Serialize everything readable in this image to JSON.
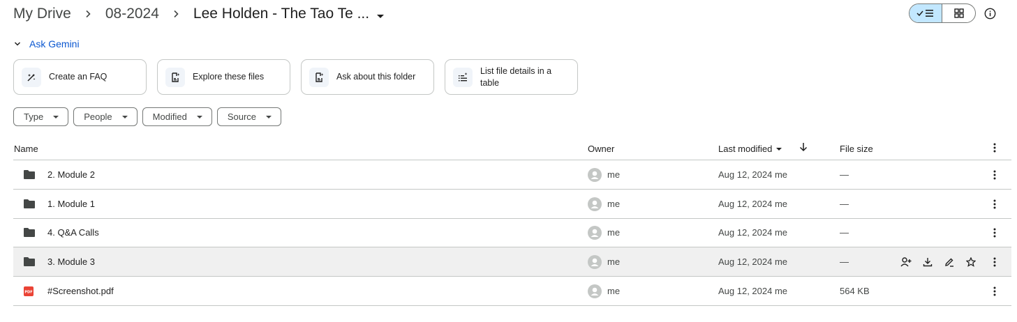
{
  "breadcrumb": {
    "root": "My Drive",
    "parent": "08-2024",
    "current": "Lee Holden - The Tao Te ..."
  },
  "gemini": {
    "label": "Ask Gemini",
    "suggestions": [
      {
        "icon": "magic-pen-icon",
        "label": "Create an FAQ"
      },
      {
        "icon": "doc-sparkle-icon",
        "label": "Explore these files"
      },
      {
        "icon": "doc-sparkle-icon",
        "label": "Ask about this folder"
      },
      {
        "icon": "list-sparkle-icon",
        "label": "List file details in a table"
      }
    ]
  },
  "filters": [
    "Type",
    "People",
    "Modified",
    "Source"
  ],
  "table": {
    "headers": {
      "name": "Name",
      "owner": "Owner",
      "last_modified": "Last modified",
      "file_size": "File size"
    },
    "rows": [
      {
        "type": "folder",
        "name": "2. Module 2",
        "owner": "me",
        "modified": "Aug 12, 2024 me",
        "size": "—"
      },
      {
        "type": "folder",
        "name": "1. Module 1",
        "owner": "me",
        "modified": "Aug 12, 2024 me",
        "size": "—"
      },
      {
        "type": "folder",
        "name": "4. Q&A Calls",
        "owner": "me",
        "modified": "Aug 12, 2024 me",
        "size": "—"
      },
      {
        "type": "folder",
        "name": "3. Module 3",
        "owner": "me",
        "modified": "Aug 12, 2024 me",
        "size": "—"
      },
      {
        "type": "pdf",
        "name": "#Screenshot.pdf",
        "owner": "me",
        "modified": "Aug 12, 2024 me",
        "size": "564 KB"
      }
    ],
    "hovered_row": 3
  },
  "colors": {
    "accent": "#0b57d0",
    "toggle_active": "#c2e7ff",
    "folder": "#444746",
    "pdf": "#ea4335"
  }
}
